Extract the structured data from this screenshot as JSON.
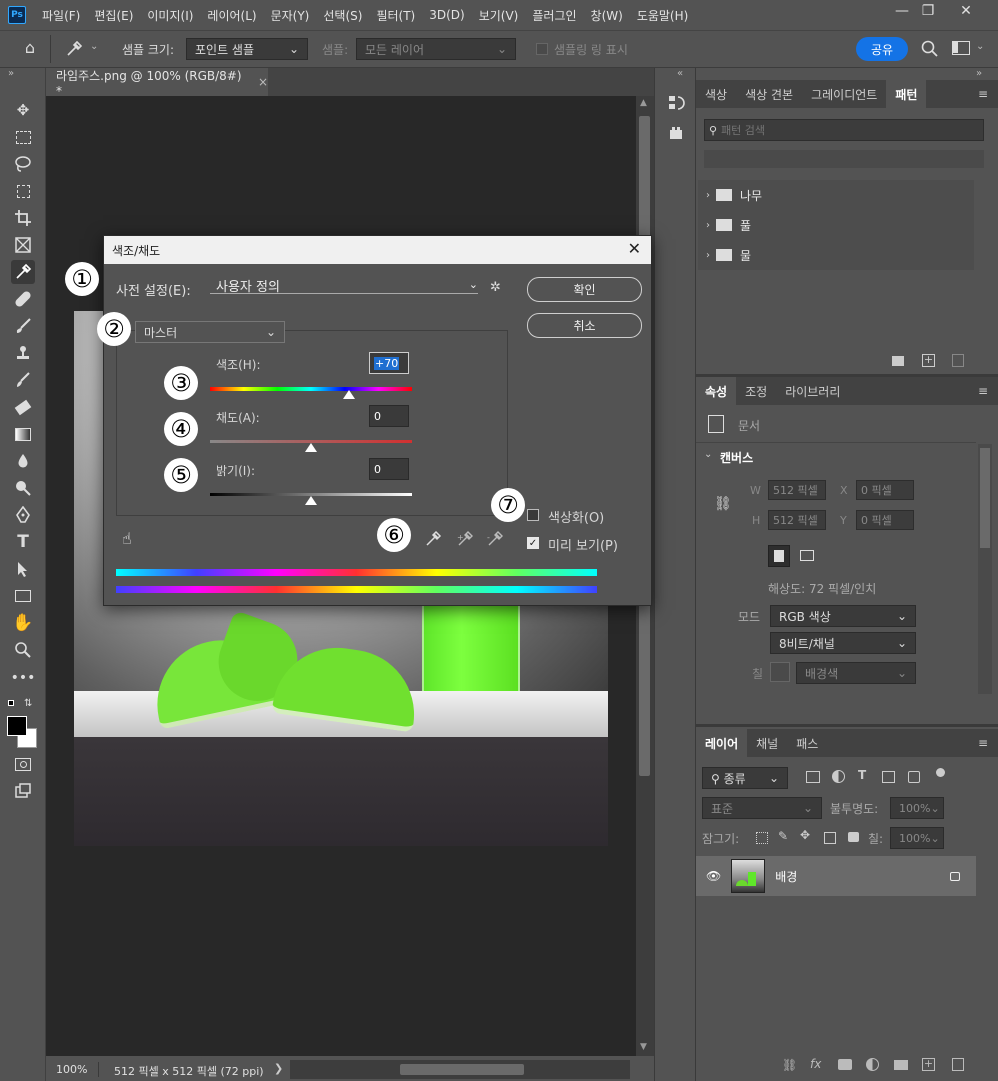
{
  "menubar": {
    "logo": "Ps",
    "items": [
      "파일(F)",
      "편집(E)",
      "이미지(I)",
      "레이어(L)",
      "문자(Y)",
      "선택(S)",
      "필터(T)",
      "3D(D)",
      "보기(V)",
      "플러그인",
      "창(W)",
      "도움말(H)"
    ],
    "minimize": "—",
    "maximize": "❐",
    "close": "✕"
  },
  "optionsbar": {
    "sample_size_label": "샘플 크기:",
    "sample_size_value": "포인트 샘플",
    "sample_label": "샘플:",
    "sample_value": "모든 레이어",
    "show_ring_label": "샘플링 링 표시",
    "share_button": "공유"
  },
  "document": {
    "tab_title": "라임주스.png @ 100% (RGB/8#) *",
    "tab_close": "×"
  },
  "statusbar": {
    "zoom": "100%",
    "info": "512 픽셀 x 512 픽셀 (72 ppi)"
  },
  "dialog": {
    "title": "색조/채도",
    "preset_label": "사전 설정(E):",
    "preset_value": "사용자 정의",
    "ok_button": "확인",
    "cancel_button": "취소",
    "channel_value": "마스터",
    "hue_label": "색조(H):",
    "hue_value": "+70",
    "saturation_label": "채도(A):",
    "saturation_value": "0",
    "lightness_label": "밝기(I):",
    "lightness_value": "0",
    "colorize_label": "색상화(O)",
    "colorize_checked": false,
    "preview_label": "미리 보기(P)",
    "preview_checked": true,
    "hue_slider_position": 0.69,
    "saturation_slider_position": 0.5,
    "lightness_slider_position": 0.5
  },
  "annotations": [
    "①",
    "②",
    "③",
    "④",
    "⑤",
    "⑥",
    "⑦"
  ],
  "panels": {
    "top_tabs": [
      "색상",
      "색상 견본",
      "그레이디언트",
      "패턴"
    ],
    "pattern_search_placeholder": "패턴 검색",
    "pattern_groups": [
      "나무",
      "풀",
      "물"
    ],
    "props_tabs": [
      "속성",
      "조정",
      "라이브러리"
    ],
    "doc_label": "문서",
    "canvas_section": "캔버스",
    "w_label": "W",
    "w_value": "512 픽셀",
    "h_label": "H",
    "h_value": "512 픽셀",
    "x_label": "X",
    "x_value": "0 픽셀",
    "y_label": "Y",
    "y_value": "0 픽셀",
    "resolution": "해상도: 72 픽셀/인치",
    "mode_label": "모드",
    "mode_value": "RGB 색상",
    "bits_value": "8비트/채널",
    "fill_label": "칠",
    "fill_value": "배경색",
    "layer_tabs": [
      "레이어",
      "채널",
      "패스"
    ],
    "filter_kind": "종류",
    "blend_mode": "표준",
    "opacity_label": "불투명도:",
    "opacity_value": "100%",
    "lock_label": "잠그기:",
    "fill2_label": "칠:",
    "fill2_value": "100%",
    "layer_name": "배경"
  }
}
